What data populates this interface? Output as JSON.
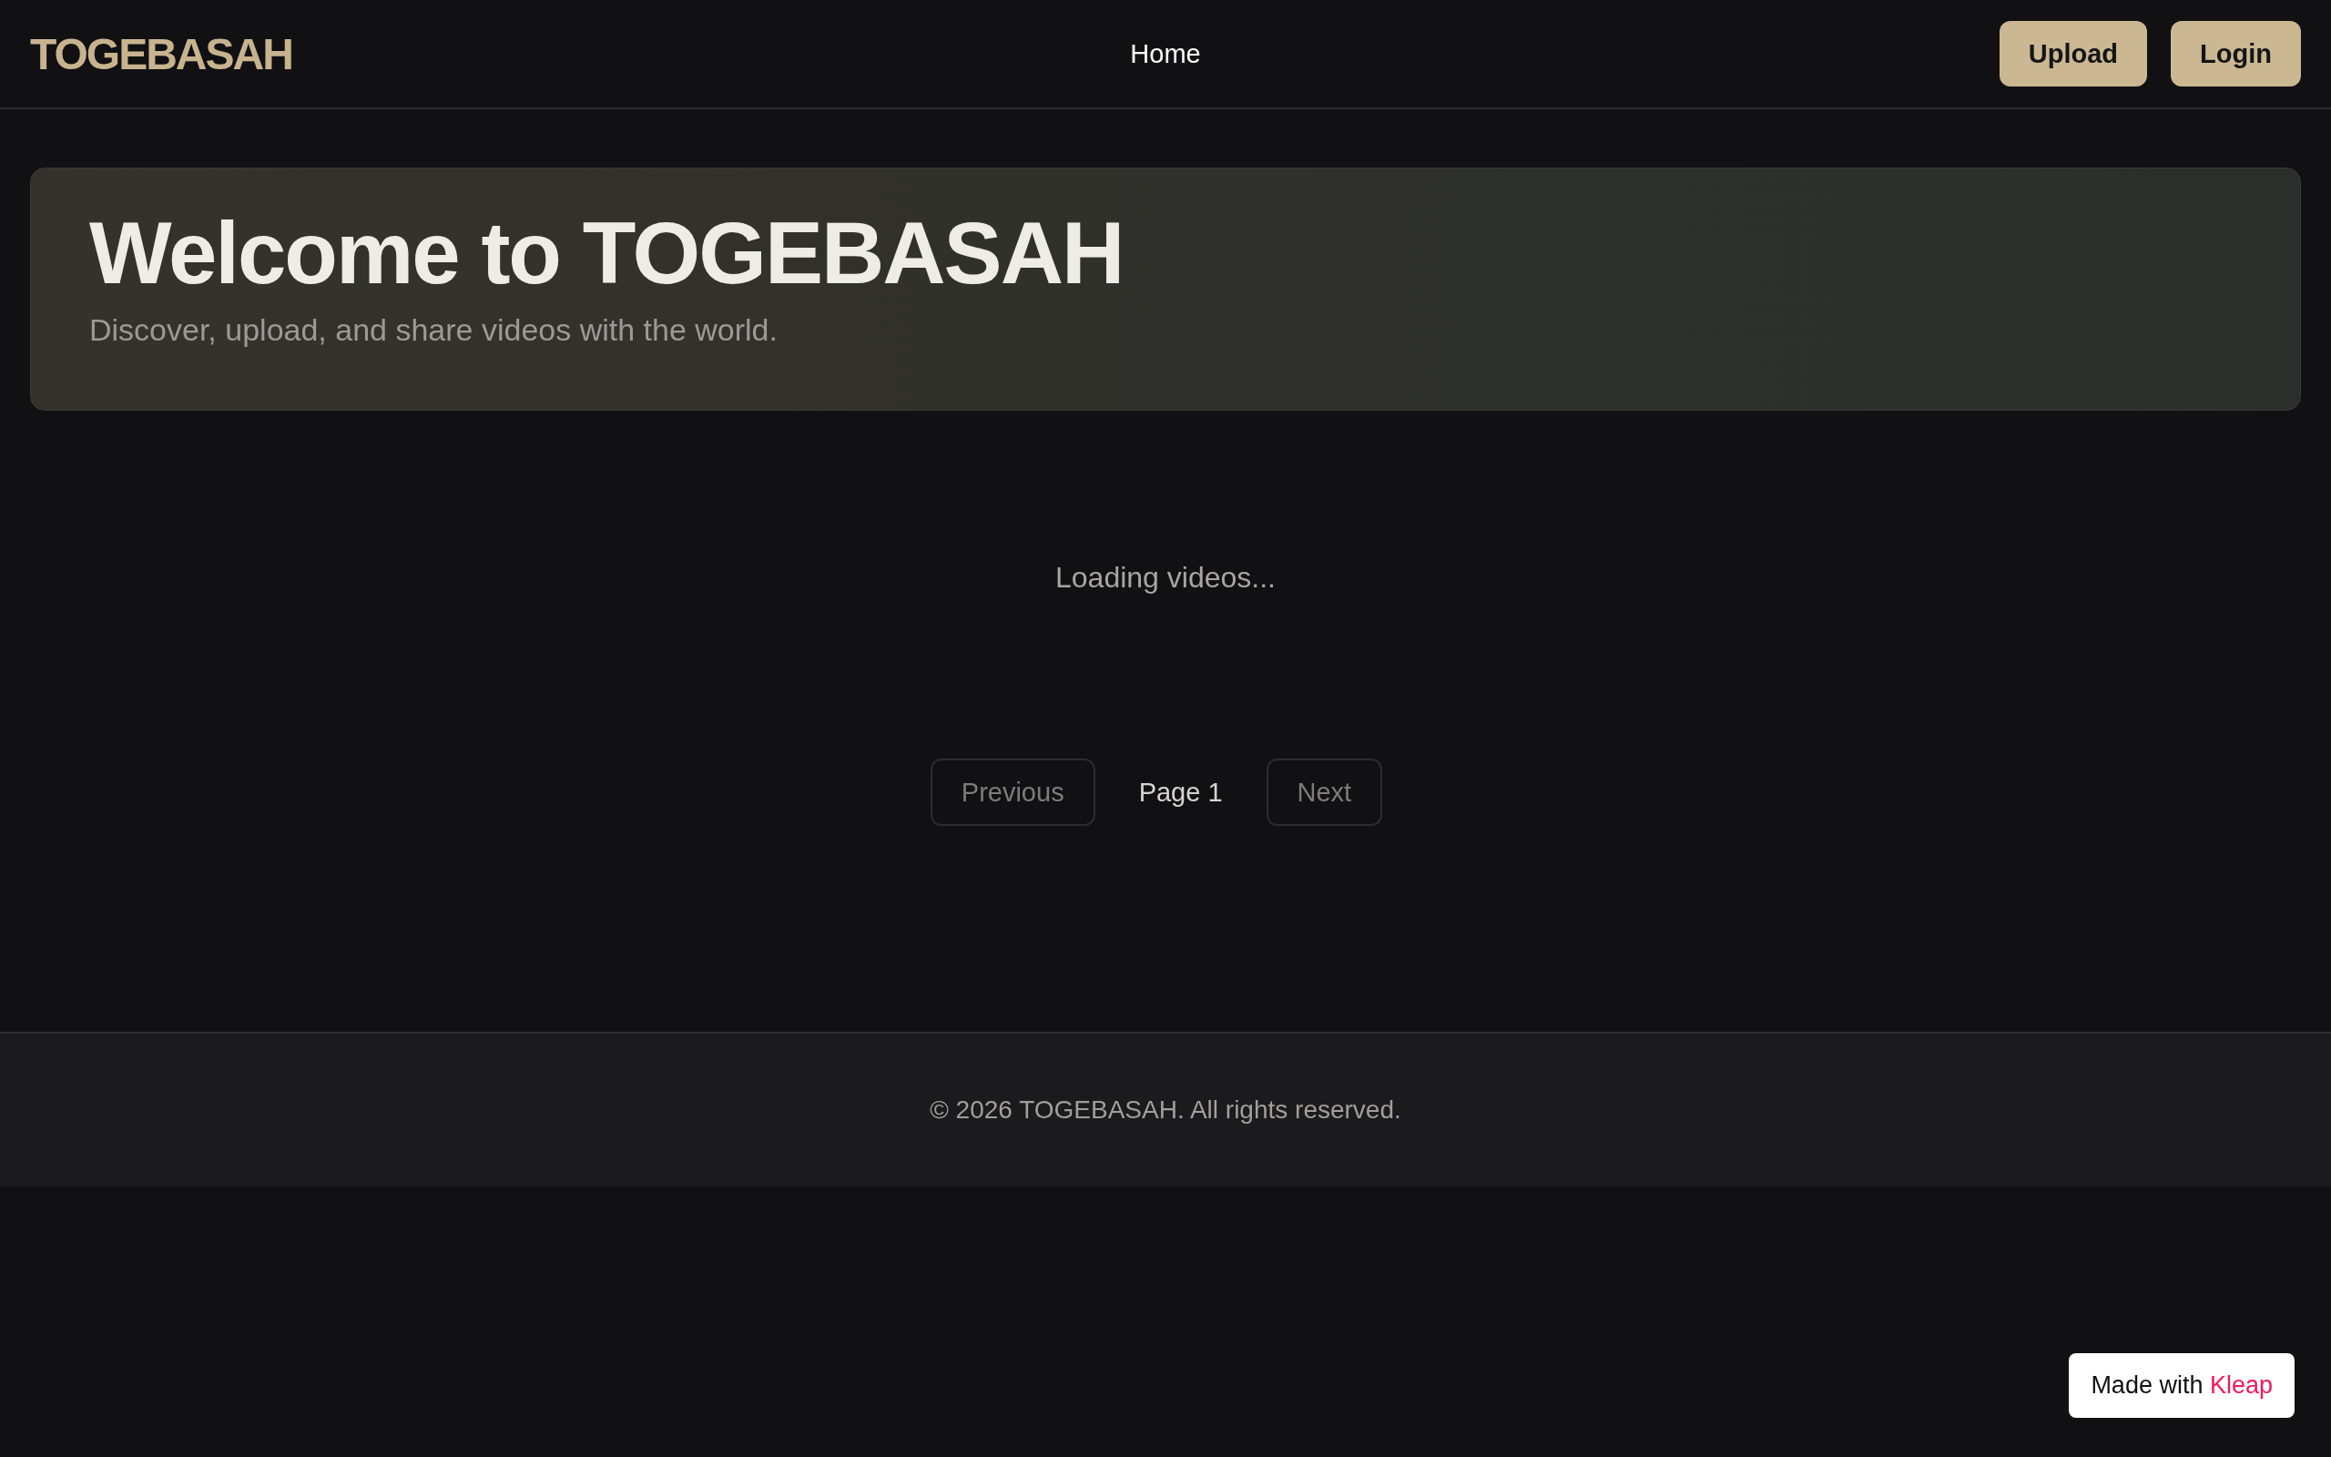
{
  "header": {
    "logo": "TOGEBASAH",
    "nav": [
      {
        "label": "Home"
      }
    ],
    "buttons": [
      "Upload",
      "Login"
    ]
  },
  "hero": {
    "title": "Welcome to TOGEBASAH",
    "subtitle": "Discover, upload, and share videos with the world."
  },
  "status": "Loading videos...",
  "pagination": {
    "previous": {
      "label": "Previous",
      "disabled": true
    },
    "page": "Page 1",
    "next": {
      "label": "Next",
      "disabled": true
    }
  },
  "footer": "© 2026 TOGEBASAH. All rights reserved.",
  "badge": {
    "text": "Made with",
    "brand": "Kleap"
  }
}
